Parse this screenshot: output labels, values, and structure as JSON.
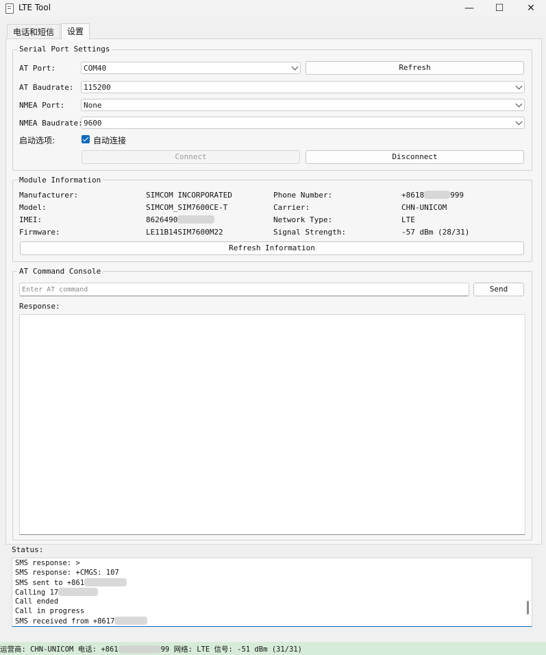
{
  "window": {
    "title": "LTE Tool",
    "minimize_glyph": "—",
    "maximize_glyph": "☐",
    "close_glyph": "✕"
  },
  "tabs": [
    {
      "label": "电话和短信"
    },
    {
      "label": "设置"
    }
  ],
  "serial": {
    "title": "Serial Port Settings",
    "at_port_label": "AT Port:",
    "at_port_value": "COM40",
    "refresh_label": "Refresh",
    "at_baud_label": "AT Baudrate:",
    "at_baud_value": "115200",
    "nmea_port_label": "NMEA Port:",
    "nmea_port_value": "None",
    "nmea_baud_label": "NMEA Baudrate:",
    "nmea_baud_value": "9600",
    "startup_label": "启动选项:",
    "autoconnect_label": "自动连接",
    "autoconnect_checked": true,
    "connect_label": "Connect",
    "disconnect_label": "Disconnect"
  },
  "module": {
    "title": "Module Information",
    "manufacturer_label": "Manufacturer:",
    "manufacturer_value": "SIMCOM INCORPORATED",
    "model_label": "Model:",
    "model_value": "SIMCOM_SIM7600CE-T",
    "imei_label": "IMEI:",
    "imei_prefix": "8626490",
    "firmware_label": "Firmware:",
    "firmware_value": "LE11B14SIM7600M22",
    "phone_label": "Phone Number:",
    "phone_prefix": "+8618",
    "phone_suffix": "999",
    "carrier_label": "Carrier:",
    "carrier_value": "CHN-UNICOM",
    "network_label": "Network Type:",
    "network_value": "LTE",
    "signal_label": "Signal Strength:",
    "signal_value": "-57 dBm (28/31)",
    "refresh_info_label": "Refresh Information"
  },
  "console": {
    "title": "AT Command Console",
    "input_placeholder": "Enter AT command",
    "send_label": "Send",
    "response_label": "Response:"
  },
  "status": {
    "label": "Status:",
    "lines": [
      "SMS response: >",
      "SMS response: +CMGS: 107",
      "SMS sent to +861",
      "Calling 17",
      "Call ended",
      "Call in progress",
      "SMS received from +8617"
    ]
  },
  "statusbar": {
    "carrier_part": "运营商: CHN-UNICOM 电话: +861",
    "rest_part": "99 网络: LTE 信号: -51 dBm (31/31)"
  },
  "colors": {
    "accent": "#0f6cbd",
    "statusbar_bg": "#d6ecd8"
  }
}
